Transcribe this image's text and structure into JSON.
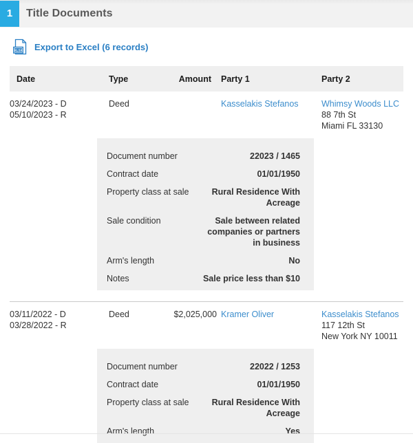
{
  "header": {
    "badge_number": "1",
    "title": "Title Documents",
    "accent_color": "#29abe2"
  },
  "export": {
    "icon": "xlsx-file-icon",
    "label": "Export to Excel (6 records)",
    "link_color": "#2a7fc4"
  },
  "table": {
    "columns": [
      "Date",
      "Type",
      "Amount",
      "Party 1",
      "Party 2"
    ],
    "rows": [
      {
        "date_line1": "03/24/2023 - D",
        "date_line2": "05/10/2023 - R",
        "type": "Deed",
        "amount": "",
        "party1": "Kasselakis Stefanos",
        "party2_name": "Whimsy Woods LLC",
        "party2_street": "88 7th St",
        "party2_city": "Miami FL 33130",
        "details": [
          {
            "label": "Document number",
            "value": "22023 / 1465"
          },
          {
            "label": "Contract date",
            "value": "01/01/1950"
          },
          {
            "label": "Property class at sale",
            "value": "Rural Residence With Acreage"
          },
          {
            "label": "Sale condition",
            "value": "Sale between related companies or partners in business"
          },
          {
            "label": "Arm's length",
            "value": "No"
          },
          {
            "label": "Notes",
            "value": "Sale price less than $10"
          }
        ]
      },
      {
        "date_line1": "03/11/2022 - D",
        "date_line2": "03/28/2022 - R",
        "type": "Deed",
        "amount": "$2,025,000",
        "party1": "Kramer Oliver",
        "party2_name": "Kasselakis Stefanos",
        "party2_street": "117 12th St",
        "party2_city": "New York NY 10011",
        "details": [
          {
            "label": "Document number",
            "value": "22022 / 1253"
          },
          {
            "label": "Contract date",
            "value": "01/01/1950"
          },
          {
            "label": "Property class at sale",
            "value": "Rural Residence With Acreage"
          },
          {
            "label": "Arm's length",
            "value": "Yes"
          }
        ]
      }
    ]
  }
}
